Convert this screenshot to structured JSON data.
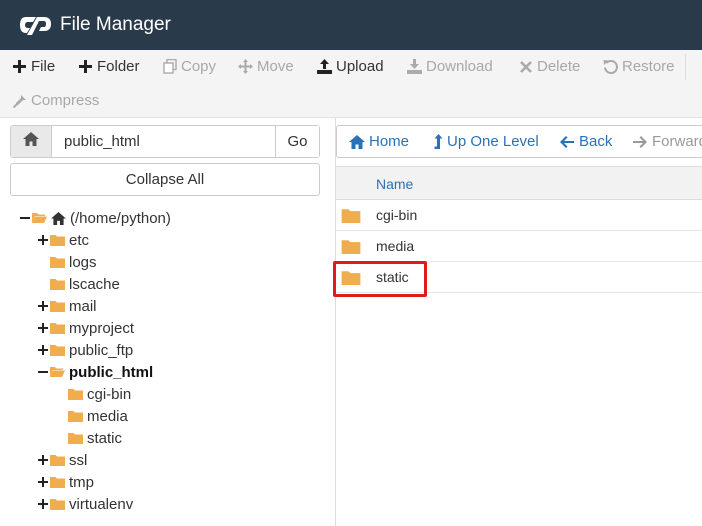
{
  "header": {
    "title": "File Manager",
    "logo": "cpanel-logo"
  },
  "toolbar": {
    "file": "File",
    "folder": "Folder",
    "copy": "Copy",
    "move": "Move",
    "upload": "Upload",
    "download": "Download",
    "delete": "Delete",
    "restore": "Restore",
    "compress": "Compress"
  },
  "left_panel": {
    "path_value": "public_html",
    "go_label": "Go",
    "collapse_label": "Collapse All",
    "tree": {
      "root": "(/home/python)",
      "etc": "etc",
      "logs": "logs",
      "lscache": "lscache",
      "mail": "mail",
      "myproject": "myproject",
      "public_ftp": "public_ftp",
      "public_html": "public_html",
      "cgi_bin": "cgi-bin",
      "media": "media",
      "static": "static",
      "ssl": "ssl",
      "tmp": "tmp",
      "virtualenv": "virtualenv"
    }
  },
  "right_panel": {
    "nav": {
      "home": "Home",
      "up": "Up One Level",
      "back": "Back",
      "forward": "Forward"
    },
    "column_name": "Name",
    "files": [
      "cgi-bin",
      "media",
      "static"
    ]
  },
  "colors": {
    "header_bg": "#293a4a",
    "link": "#2a72b5",
    "folder": "#f0ad4e",
    "highlight": "#e01b1b"
  }
}
